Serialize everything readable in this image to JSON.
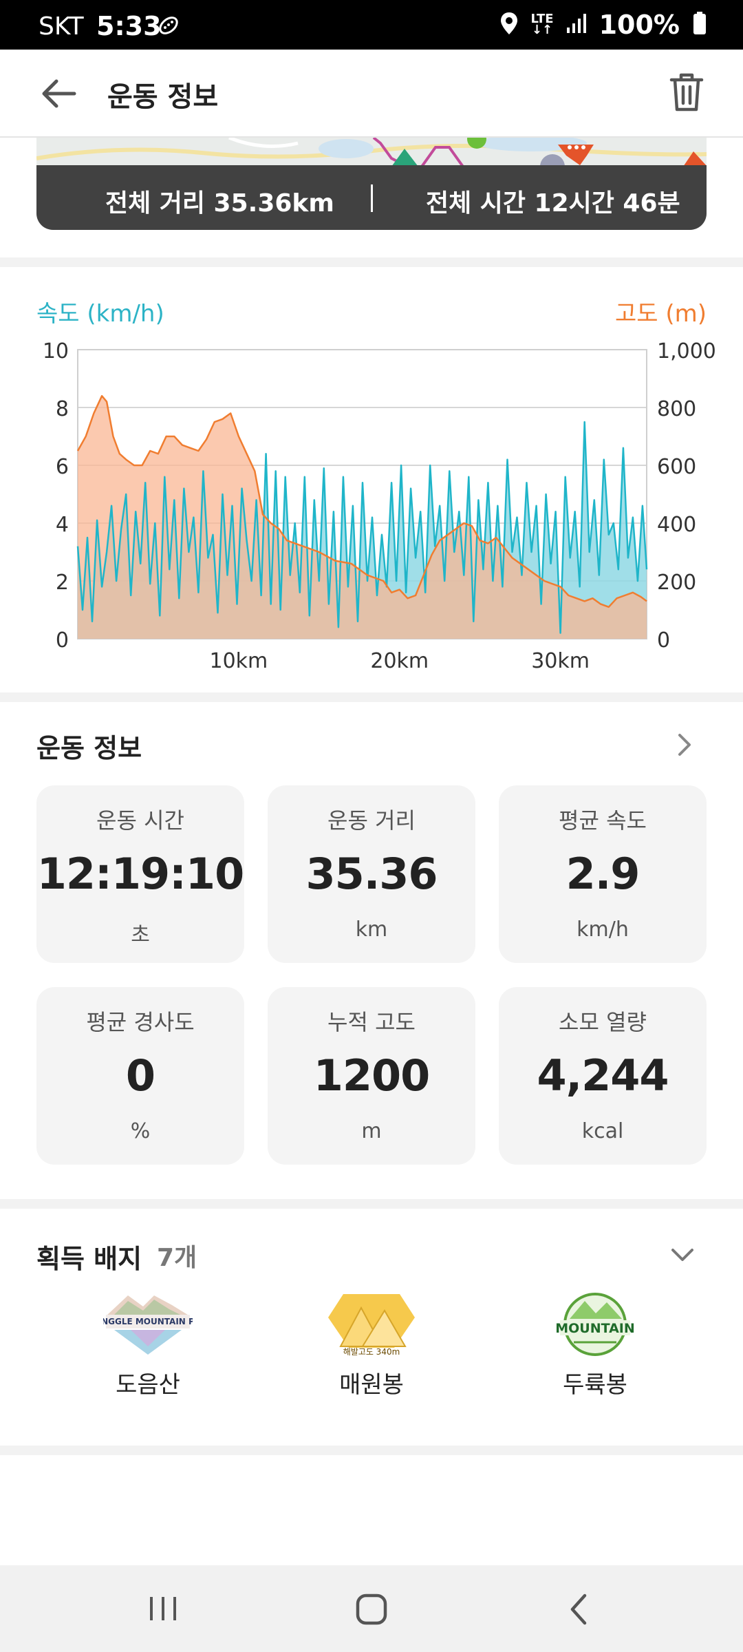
{
  "status_bar": {
    "carrier": "SKT",
    "time": "5:33",
    "network": "LTE",
    "battery": "100%"
  },
  "app_bar": {
    "title": "운동 정보",
    "back_icon": "arrow-left-icon",
    "delete_icon": "trash-icon"
  },
  "summary": {
    "distance": "전체 거리 35.36km",
    "duration": "전체 시간 12시간 46분"
  },
  "chart_data": {
    "type": "line",
    "y_left_label": "속도 (km/h)",
    "y_right_label": "고도 (m)",
    "left_ticks": [
      "0",
      "2",
      "4",
      "6",
      "8",
      "10"
    ],
    "right_ticks": [
      "0",
      "200",
      "400",
      "600",
      "800",
      "1,000"
    ],
    "x_ticks": [
      "10km",
      "20km",
      "30km"
    ],
    "x_tick_values": [
      10,
      20,
      30
    ],
    "xlim": [
      0,
      35.36
    ],
    "ylim_left": [
      0,
      10
    ],
    "ylim_right": [
      0,
      1000
    ],
    "grid": true,
    "series": [
      {
        "name": "고도 (m)",
        "axis": "right",
        "color": "#f07d30",
        "fill": "#f9b794",
        "x": [
          0,
          0.5,
          1,
          1.5,
          1.8,
          2.2,
          2.6,
          3,
          3.5,
          4,
          4.5,
          5,
          5.5,
          6,
          6.5,
          7,
          7.5,
          8,
          8.5,
          9,
          9.5,
          10,
          10.5,
          11,
          11.5,
          12,
          12.5,
          13,
          14,
          15,
          16,
          17,
          18,
          19,
          19.5,
          20,
          20.5,
          21,
          21.5,
          22,
          22.5,
          23,
          23.5,
          24,
          24.5,
          25,
          25.5,
          26,
          27,
          28,
          29,
          30,
          30.5,
          31,
          31.5,
          32,
          32.5,
          33,
          33.5,
          34,
          34.5,
          35,
          35.36
        ],
        "values": [
          650,
          700,
          780,
          840,
          820,
          700,
          640,
          620,
          600,
          600,
          650,
          640,
          700,
          700,
          670,
          660,
          650,
          690,
          750,
          760,
          780,
          700,
          640,
          580,
          430,
          400,
          380,
          340,
          320,
          300,
          270,
          260,
          220,
          200,
          160,
          170,
          140,
          150,
          220,
          290,
          340,
          360,
          380,
          400,
          390,
          340,
          330,
          350,
          280,
          240,
          200,
          180,
          150,
          140,
          130,
          140,
          120,
          110,
          140,
          150,
          160,
          145,
          130
        ]
      },
      {
        "name": "속도 (km/h)",
        "axis": "left",
        "color": "#1fb5c9",
        "fill": "#8fd8e4",
        "x": [
          0,
          0.3,
          0.6,
          0.9,
          1.2,
          1.5,
          1.8,
          2.1,
          2.4,
          2.7,
          3,
          3.3,
          3.6,
          3.9,
          4.2,
          4.5,
          4.8,
          5.1,
          5.4,
          5.7,
          6,
          6.3,
          6.6,
          6.9,
          7.2,
          7.5,
          7.8,
          8.1,
          8.4,
          8.7,
          9,
          9.3,
          9.6,
          9.9,
          10.2,
          10.5,
          10.8,
          11.1,
          11.4,
          11.7,
          12,
          12.3,
          12.6,
          12.9,
          13.2,
          13.5,
          13.8,
          14.1,
          14.4,
          14.7,
          15,
          15.3,
          15.6,
          15.9,
          16.2,
          16.5,
          16.8,
          17.1,
          17.4,
          17.7,
          18,
          18.3,
          18.6,
          18.9,
          19.2,
          19.5,
          19.8,
          20.1,
          20.4,
          20.7,
          21,
          21.3,
          21.6,
          21.9,
          22.2,
          22.5,
          22.8,
          23.1,
          23.4,
          23.7,
          24,
          24.3,
          24.6,
          24.9,
          25.2,
          25.5,
          25.8,
          26.1,
          26.4,
          26.7,
          27,
          27.3,
          27.6,
          27.9,
          28.2,
          28.5,
          28.8,
          29.1,
          29.4,
          29.7,
          30,
          30.3,
          30.6,
          30.9,
          31.2,
          31.5,
          31.8,
          32.1,
          32.4,
          32.7,
          33,
          33.3,
          33.6,
          33.9,
          34.2,
          34.5,
          34.8,
          35.1,
          35.36
        ],
        "values": [
          3.2,
          1.0,
          3.5,
          0.6,
          4.1,
          1.8,
          3.0,
          4.6,
          2.0,
          3.8,
          5.0,
          1.5,
          4.4,
          2.6,
          5.4,
          1.9,
          4.0,
          0.8,
          5.6,
          2.4,
          4.8,
          1.4,
          5.2,
          3.0,
          4.2,
          1.6,
          5.8,
          2.8,
          3.6,
          0.9,
          5.0,
          2.2,
          4.6,
          1.2,
          5.2,
          3.4,
          2.0,
          4.8,
          1.5,
          6.4,
          1.2,
          5.8,
          1.0,
          5.6,
          2.2,
          4.0,
          1.6,
          5.6,
          0.8,
          4.8,
          2.0,
          5.9,
          1.2,
          4.4,
          0.4,
          5.6,
          1.8,
          4.6,
          0.6,
          5.4,
          2.0,
          4.2,
          1.5,
          3.6,
          1.8,
          5.4,
          2.0,
          6.0,
          1.6,
          5.2,
          2.8,
          4.4,
          1.6,
          6.0,
          3.2,
          4.6,
          2.0,
          5.8,
          3.0,
          4.4,
          2.2,
          5.6,
          0.6,
          4.8,
          2.4,
          5.4,
          2.0,
          4.6,
          1.8,
          6.2,
          3.0,
          4.2,
          2.2,
          5.4,
          3.0,
          4.6,
          1.2,
          5.0,
          2.6,
          4.4,
          0.2,
          5.6,
          2.8,
          4.4,
          1.8,
          7.5,
          3.0,
          4.8,
          2.2,
          6.2,
          3.6,
          4.0,
          2.4,
          6.6,
          2.8,
          4.2,
          2.0,
          4.6,
          2.4
        ]
      }
    ]
  },
  "workout": {
    "title": "운동 정보",
    "stats": [
      {
        "label": "운동 시간",
        "value": "12:19:10",
        "unit": "초"
      },
      {
        "label": "운동 거리",
        "value": "35.36",
        "unit": "km"
      },
      {
        "label": "평균 속도",
        "value": "2.9",
        "unit": "km/h"
      },
      {
        "label": "평균 경사도",
        "value": "0",
        "unit": "%"
      },
      {
        "label": "누적 고도",
        "value": "1200",
        "unit": "m"
      },
      {
        "label": "소모 열량",
        "value": "4,244",
        "unit": "kcal"
      }
    ]
  },
  "badges": {
    "title": "획득 배지",
    "count": "7개",
    "items": [
      {
        "name": "도음산",
        "art_text": "TRANGGLE MOUNTAIN PEAK"
      },
      {
        "name": "매원봉",
        "art_text": "해발고도 340m"
      },
      {
        "name": "두륙봉",
        "art_text": "MOUNTAIN"
      }
    ]
  },
  "colors": {
    "speed": "#1fb5c9",
    "altitude": "#f07d30",
    "summary_bg": "#414141"
  }
}
